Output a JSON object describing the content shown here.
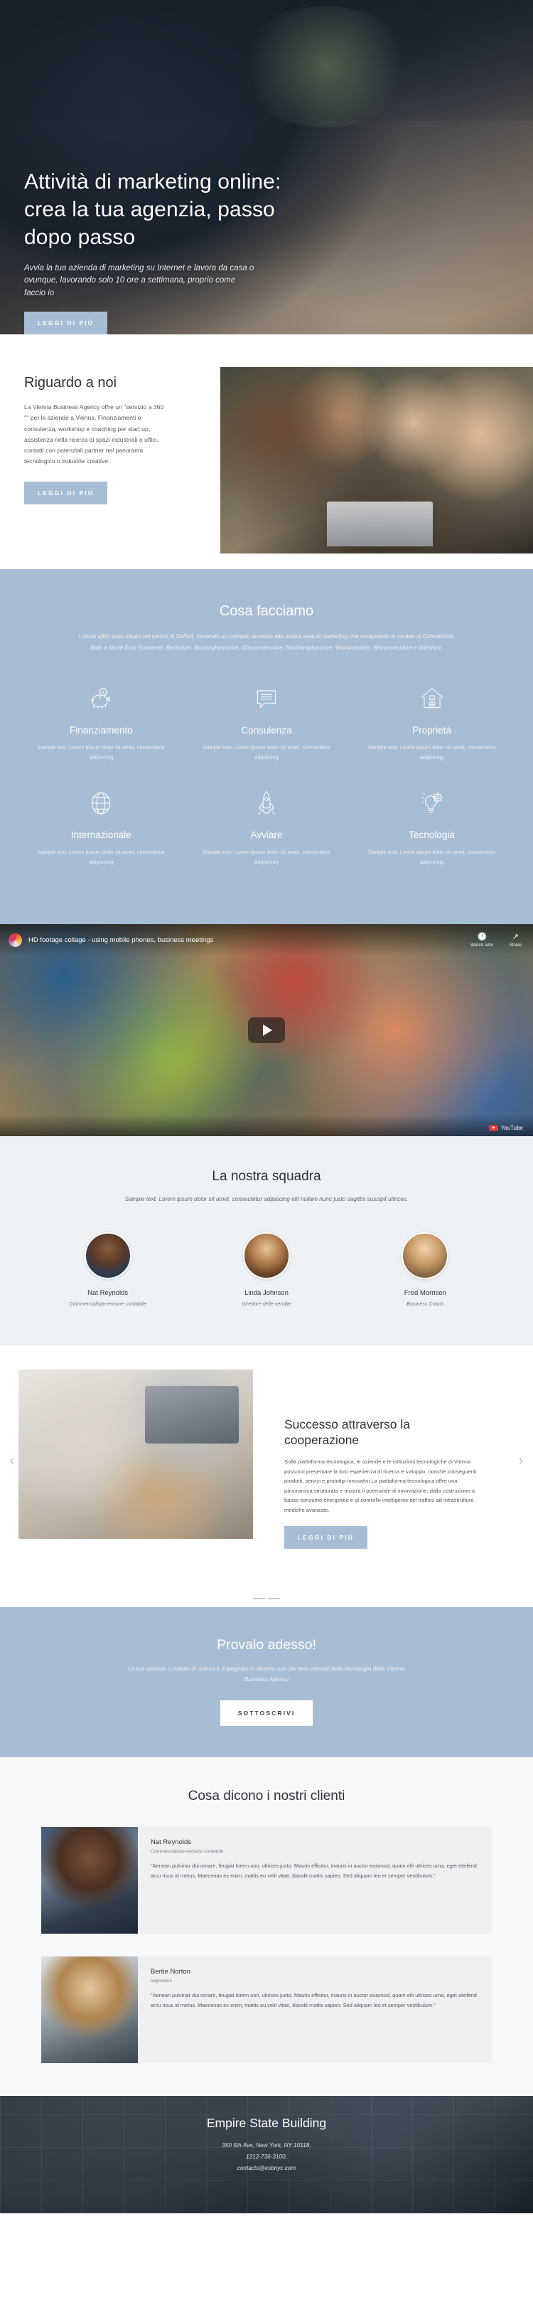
{
  "hero": {
    "title": "Attività di marketing online: crea la tua agenzia, passo dopo passo",
    "subtitle": "Avvia la tua azienda di marketing su Internet e lavora da casa o ovunque, lavorando solo 10 ore a settimana, proprio come faccio io",
    "cta_label": "LEGGI DI PIÙ"
  },
  "about": {
    "title": "Riguardo a noi",
    "paragraph": "La Vienna Business Agency offre un \"servizio a 360 °\" per le aziende a Vienna. Finanziamenti e consulenza, workshop e coaching per start up, assistenza nella ricerca di spazi industriali o uffici, contatti con potenziali partner nel panorama tecnologico o industrie creative.",
    "cta_label": "LEGGI DI PIÙ"
  },
  "services": {
    "title": "Cosa facciamo",
    "intro": "I nostri uffici sono situati nel centro di Oxford, fornendo un comodo accesso alla nostra area di marketing che comprende le contee di Oxfordshire, Bath e North East Somerset, Berkshire, Buckinghamshire, Gloucestershire, Northamptonshire, Warwickshire, Worcestershire e Wiltshire.",
    "items": [
      {
        "icon": "piggy-bank-icon",
        "title": "Finanziamento",
        "text": "Sample text. Lorem ipsum dolor sit amet, consectetur adipiscing"
      },
      {
        "icon": "chat-bubble-icon",
        "title": "Consulenza",
        "text": "Sample text. Lorem ipsum dolor sit amet, consectetur adipiscing"
      },
      {
        "icon": "house-icon",
        "title": "Proprietà",
        "text": "Sample text. Lorem ipsum dolor sit amet, consectetur adipiscing"
      },
      {
        "icon": "globe-icon",
        "title": "Internazionale",
        "text": "Sample text. Lorem ipsum dolor sit amet, consectetur adipiscing"
      },
      {
        "icon": "rocket-icon",
        "title": "Avviare",
        "text": "Sample text. Lorem ipsum dolor sit amet, consectetur adipiscing"
      },
      {
        "icon": "lightbulb-gear-icon",
        "title": "Tecnologia",
        "text": "Sample text. Lorem ipsum dolor sit amet, consectetur adipiscing"
      }
    ]
  },
  "video": {
    "title": "HD footage collage - using mobile phones, business meetings",
    "watch_later_label": "Watch later",
    "share_label": "Share",
    "brand_label": "YouTube"
  },
  "team": {
    "title": "La nostra squadra",
    "intro": "Sample text. Lorem ipsum dolor sit amet, consectetur adipiscing elit nullam nunc justo sagittis suscipit ultrices.",
    "members": [
      {
        "name": "Nat Reynolds",
        "role": "Commercialista-revisore contabile"
      },
      {
        "name": "Linda Johnson",
        "role": "Direttore delle vendite"
      },
      {
        "name": "Fred Morrison",
        "role": "Business Coach"
      }
    ]
  },
  "cooperation": {
    "title": "Successo attraverso la cooperazione",
    "paragraph": "Sulla piattaforma tecnologica, le aziende e le istituzioni tecnologiche di Vienna possono presentare la loro esperienza di ricerca e sviluppo, nonché conseguenti prodotti, servizi e prototipi innovativi.La piattaforma tecnologica offre una panoramica strutturata e mostra il potenziale di innovazione, dalla costruzione a basso consumo energetico e al controllo intelligente del traffico ad infrastrutture mediche avanzate.",
    "cta_label": "LEGGI DI PIÙ",
    "prev_glyph": "‹",
    "next_glyph": "›"
  },
  "cta": {
    "title": "Provalo adesso!",
    "subtitle": "La tua azienda o istituto di ricerca è impegnato in almeno uno dei temi centrali della tecnologia della Vienna Business Agency",
    "button_label": "SOTTOSCRIVI"
  },
  "testimonials": {
    "title": "Cosa dicono i nostri clienti",
    "items": [
      {
        "name": "Nat Reynolds",
        "role": "Commercialista-revisore contabile",
        "quote": "\"Aenean pulvinar dui ornare, feugiat lorem non, ultrices justo. Mauris efficitur, mauris in auctor euismod, quam elit ultrices urna, eget eleifend arcu risus id metus. Maecenas ex enim, mattis eu velit vitae, blandit mattis sapien. Sed aliquam leo et semper vestibulum.\""
      },
      {
        "name": "Bertie Norton",
        "role": "segretario",
        "quote": "\"Aenean pulvinar dui ornare, feugiat lorem non, ultrices justo. Mauris efficitur, mauris in auctor euismod, quam elit ultrices urna, eget eleifend arcu risus id metus. Maecenas ex enim, mattis eu velit vitae, blandit mattis sapien. Sed aliquam leo et semper vestibulum.\""
      }
    ]
  },
  "footer": {
    "title": "Empire State Building",
    "address_line1": "350 5th Ave, New York, NY 10118,",
    "address_line2": "1212-736-3100,",
    "address_line3": "contacts@esbnyc.com"
  },
  "colors": {
    "accent": "#a7bdd4",
    "light_bg": "#eef1f6",
    "testimonial_bg": "#f7f8fa"
  }
}
